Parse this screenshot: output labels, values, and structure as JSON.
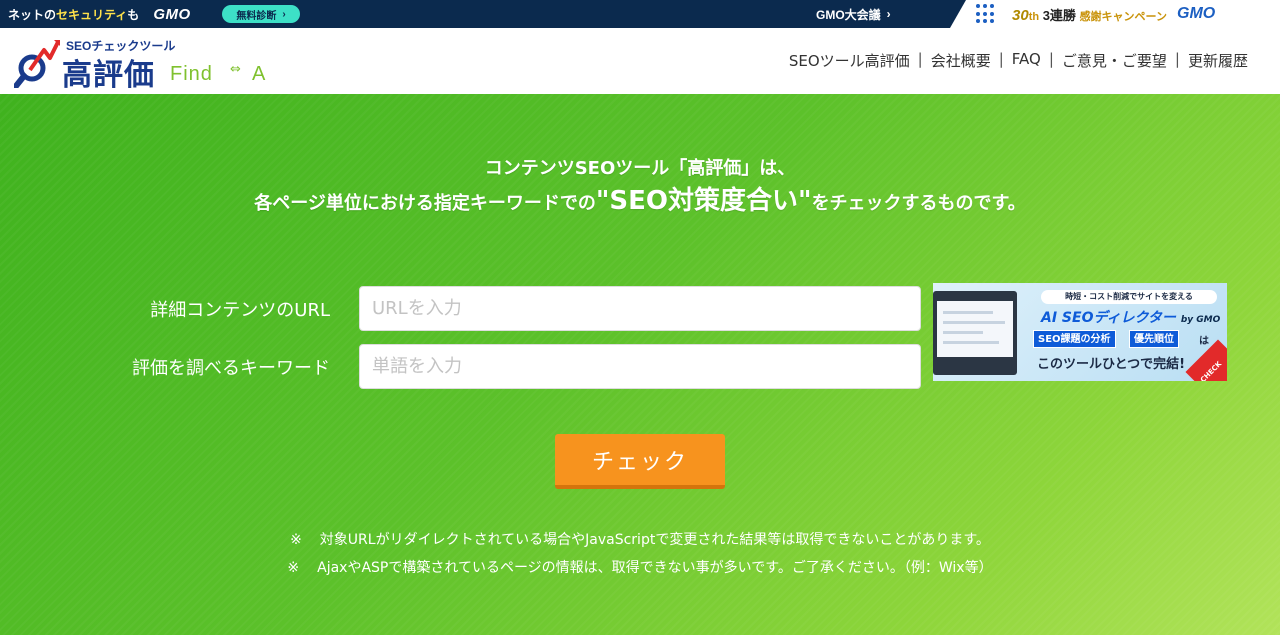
{
  "topbar": {
    "tagline_pre": "ネットの",
    "tagline_hl": "セキュリティ",
    "tagline_post": "も",
    "brand": "GMO",
    "pill_label": "無料診断",
    "pill_arrow": "›",
    "meeting": "GMO大会議",
    "meeting_arrow": "›",
    "campaign_num": "30",
    "campaign_unit": "th",
    "campaign_text": "3連勝",
    "campaign_sub": "感謝キャンペーン",
    "campaign_brand": "GMO"
  },
  "header": {
    "logo_sub": "SEOチェックツール",
    "logo_main": "高評価",
    "logo_find": "Find",
    "logo_arrow": "⇔",
    "logo_a": "A",
    "nav": [
      {
        "label": "SEOツール高評価"
      },
      {
        "label": "会社概要"
      },
      {
        "label": "FAQ"
      },
      {
        "label": "ご意見・ご要望"
      },
      {
        "label": "更新履歴"
      }
    ],
    "nav_separator": "|"
  },
  "hero": {
    "lead_line1": "コンテンツSEOツール「高評価」は、",
    "lead_line2_pre": "各ページ単位における指定キーワードでの",
    "lead_line2_big": "\"SEO対策度合い\"",
    "lead_line2_post": "をチェックするものです。"
  },
  "form": {
    "url_label": "詳細コンテンツのURL",
    "url_placeholder": "URLを入力",
    "keyword_label": "評価を調べるキーワード",
    "keyword_placeholder": "単語を入力",
    "submit_label": "チェック"
  },
  "ad": {
    "top_text": "時短・コスト削減でサイトを変える",
    "title": "AI SEOディレクター",
    "title_by": "by GMO",
    "tag1": "SEO課題の分析",
    "tag2": "優先順位",
    "ha": "は",
    "footer": "このツールひとつで完結!",
    "corner": "CHECK"
  },
  "notes": [
    {
      "mark": "※",
      "text": "対象URLがリダイレクトされている場合やJavaScriptで変更された結果等は取得できないことがあります。"
    },
    {
      "mark": "※",
      "text": "AjaxやASPで構築されているページの情報は、取得できない事が多いです。ご了承ください。（例：Wix等）"
    }
  ],
  "colors": {
    "topbar_bg": "#0b2a4e",
    "hero_green": "#5cc12a",
    "button_orange": "#f7931e",
    "logo_navy": "#1a3b8c",
    "logo_green": "#7fc12e"
  }
}
